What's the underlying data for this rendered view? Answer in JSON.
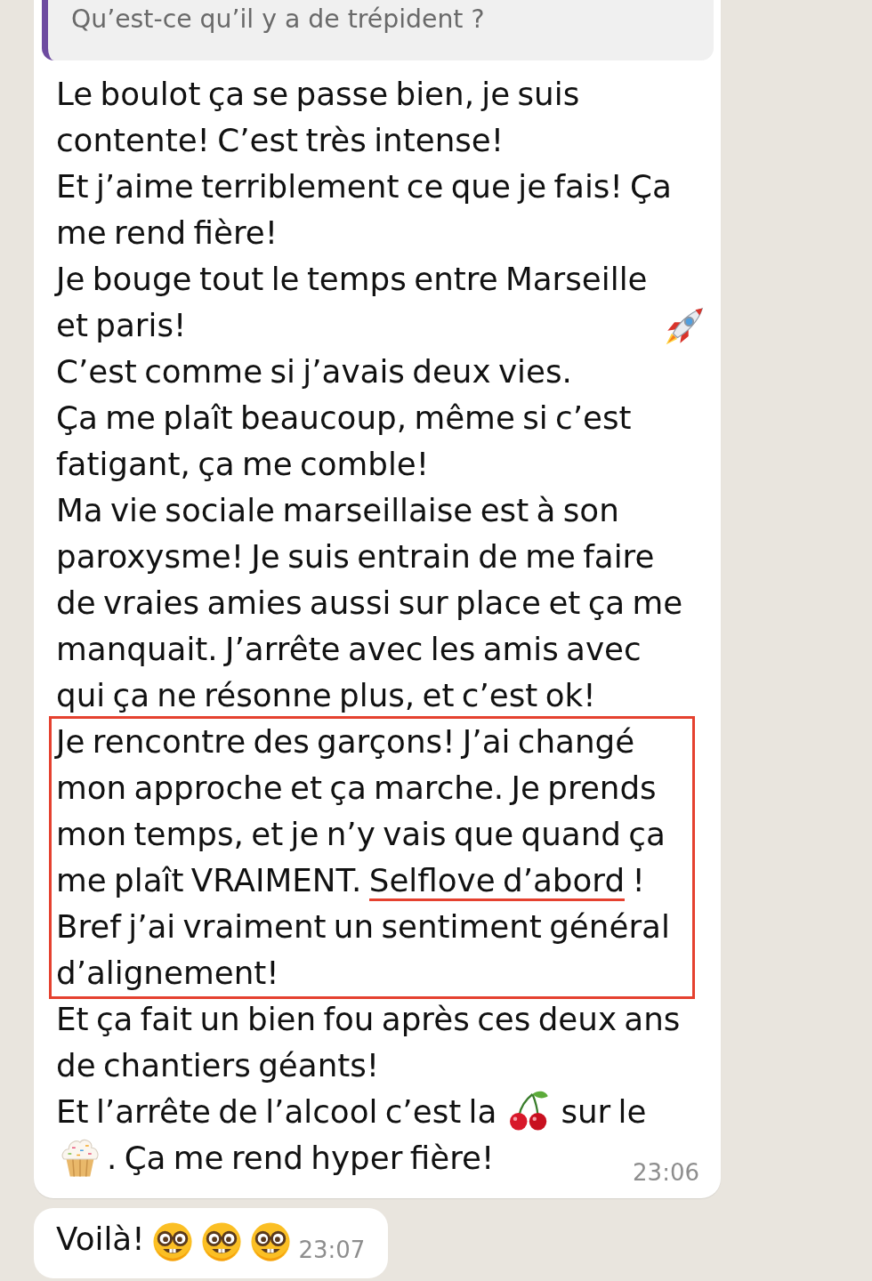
{
  "message": {
    "quote": {
      "text": "Qu’est-ce qu’il y a de trépident ?"
    },
    "sections": [
      {
        "highlighted": false,
        "paragraphs": [
          {
            "parts": [
              {
                "kind": "text",
                "text": "Le boulot ça se passe bien, je suis contente! C’est très intense!"
              }
            ]
          },
          {
            "parts": [
              {
                "kind": "text",
                "text": "Et j’aime terriblement ce que je fais! Ça me rend fière!"
              }
            ]
          },
          {
            "parts": [
              {
                "kind": "text",
                "text": "Je bouge tout le temps entre Marseille et paris!"
              },
              {
                "kind": "rocket"
              }
            ]
          },
          {
            "parts": [
              {
                "kind": "text",
                "text": "C’est comme si j’avais deux vies."
              }
            ]
          },
          {
            "parts": [
              {
                "kind": "text",
                "text": "Ça me plaît beaucoup, même si c’est fatigant, ça me comble!"
              }
            ]
          },
          {
            "parts": [
              {
                "kind": "text",
                "text": "Ma vie sociale marseillaise est à son paroxysme! Je suis entrain de me faire de vraies amies aussi sur place et ça me manquait. J’arrête avec les amis avec qui ça ne résonne plus, et c’est ok!"
              }
            ]
          }
        ]
      },
      {
        "highlighted": true,
        "paragraphs": [
          {
            "parts": [
              {
                "kind": "text",
                "text": "Je rencontre des garçons! J’ai changé mon approche et ça marche. Je prends mon temps, et je n’y vais que quand ça me plaît VRAIMENT. "
              },
              {
                "kind": "underlined",
                "text": "Selflove d’abord"
              },
              {
                "kind": "text",
                "text": " !"
              }
            ]
          },
          {
            "parts": [
              {
                "kind": "text",
                "text": "Bref j’ai vraiment un sentiment général d’alignement!"
              }
            ]
          }
        ]
      },
      {
        "highlighted": false,
        "paragraphs": [
          {
            "parts": [
              {
                "kind": "text",
                "text": "Et ça fait un bien fou après ces deux ans de chantiers géants!"
              }
            ]
          },
          {
            "parts": [
              {
                "kind": "text",
                "text": "Et l’arrête de l’alcool c’est la"
              },
              {
                "kind": "cherries"
              },
              {
                "kind": "text",
                "text": "sur le"
              },
              {
                "kind": "cupcake"
              },
              {
                "kind": "text",
                "text": ". Ça me rend hyper fière!"
              }
            ]
          }
        ]
      }
    ],
    "time": "23:06"
  },
  "reply": {
    "parts": [
      {
        "kind": "text",
        "text": "Voilà!"
      },
      {
        "kind": "nerd_face"
      },
      {
        "kind": "nerd_face"
      },
      {
        "kind": "nerd_face"
      }
    ],
    "time": "23:07"
  }
}
